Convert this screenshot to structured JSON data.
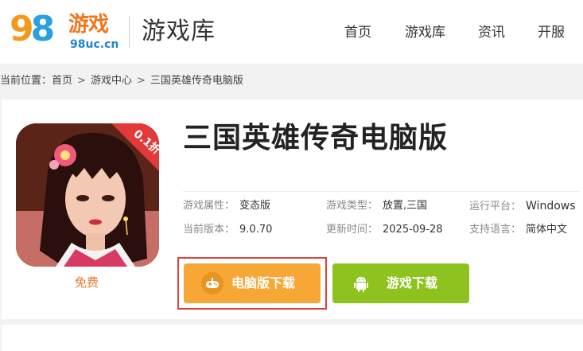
{
  "header": {
    "logo": {
      "digits_9": "9",
      "digits_8": "8",
      "game_text": "游戏",
      "url_text": "98uc.cn"
    },
    "site_title": "游戏库",
    "nav": [
      "首页",
      "游戏库",
      "资讯",
      "开服"
    ]
  },
  "breadcrumb": {
    "prefix": "当前位置：",
    "items": [
      "首页",
      "游戏中心",
      "三国英雄传奇电脑版"
    ],
    "separator": ">"
  },
  "game": {
    "title": "三国英雄传奇电脑版",
    "badge_text": "0.1折",
    "price": "免费",
    "info": [
      {
        "label": "游戏属性：",
        "value": "变态版"
      },
      {
        "label": "游戏类型：",
        "value": "放置,三国"
      },
      {
        "label": "运行平台：",
        "value": "Windows"
      },
      {
        "label": "当前版本：",
        "value": "9.0.70"
      },
      {
        "label": "更新时间：",
        "value": "2025-09-28"
      },
      {
        "label": "支持语言：",
        "value": "简体中文"
      }
    ]
  },
  "buttons": {
    "pc_download": "电脑版下载",
    "game_download": "游戏下载"
  },
  "colors": {
    "orange_button": "#f7a736",
    "green_button": "#8dc21f",
    "highlight_border": "#e0413b",
    "price_color": "#e8762a"
  },
  "icons": {
    "pc_button": "gamepad-icon",
    "android_button": "android-icon"
  }
}
